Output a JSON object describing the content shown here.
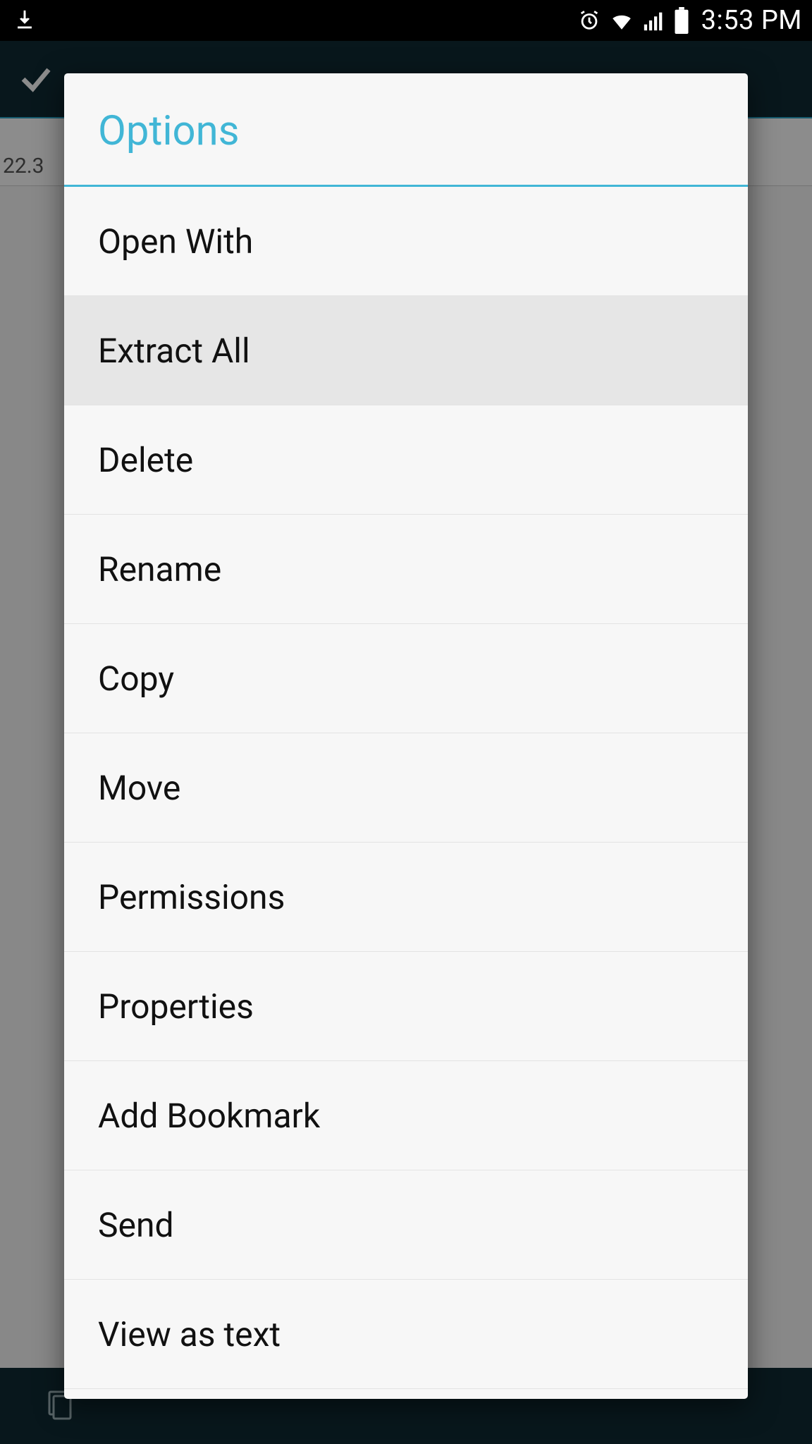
{
  "status": {
    "time": "3:53 PM"
  },
  "background": {
    "file_size_fragment": "22.3"
  },
  "dialog": {
    "title": "Options",
    "items": [
      {
        "label": "Open With",
        "highlight": false
      },
      {
        "label": "Extract All",
        "highlight": true
      },
      {
        "label": "Delete",
        "highlight": false
      },
      {
        "label": "Rename",
        "highlight": false
      },
      {
        "label": "Copy",
        "highlight": false
      },
      {
        "label": "Move",
        "highlight": false
      },
      {
        "label": "Permissions",
        "highlight": false
      },
      {
        "label": "Properties",
        "highlight": false
      },
      {
        "label": "Add Bookmark",
        "highlight": false
      },
      {
        "label": "Send",
        "highlight": false
      },
      {
        "label": "View as text",
        "highlight": false
      }
    ]
  }
}
